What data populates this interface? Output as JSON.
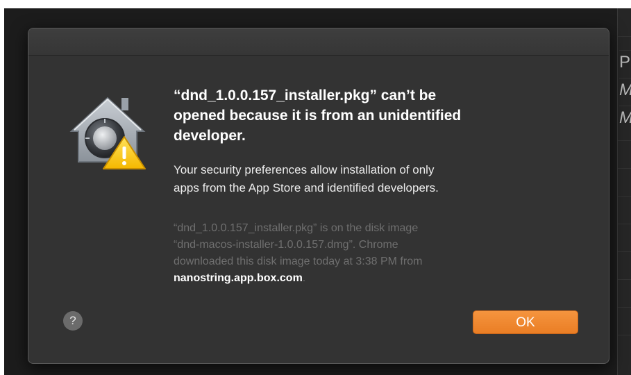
{
  "dialog": {
    "heading_lines": [
      "“dnd_1.0.0.157_installer.pkg” can’t be",
      "opened because it is from an unidentified",
      "developer."
    ],
    "info_lines": [
      "Your security preferences allow installation of only",
      "apps from the App Store and identified developers."
    ],
    "details_lines": [
      "“dnd_1.0.0.157_installer.pkg” is on the disk image",
      "“dnd-macos-installer-1.0.0.157.dmg”. Chrome",
      "downloaded this disk image today at 3:38 PM from"
    ],
    "details_domain": "nanostring.app.box.com",
    "details_domain_suffix": ".",
    "help_label": "?",
    "ok_label": "OK",
    "icon": "security-gatekeeper-warning-icon"
  },
  "background_window": {
    "rows": [
      "P",
      "M",
      "M"
    ]
  },
  "colors": {
    "dialog_bg": "#333333",
    "accent_button": "#ef8a2e",
    "heading_text": "#ffffff",
    "muted_text": "#6f6f6f"
  }
}
